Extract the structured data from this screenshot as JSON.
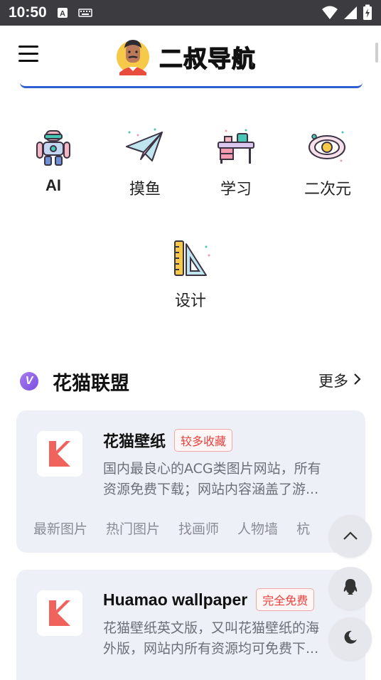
{
  "status_bar": {
    "time": "10:50",
    "icons": [
      "a-notification-icon",
      "keyboard-icon",
      "wifi-icon",
      "signal-icon",
      "battery-charging-icon"
    ]
  },
  "header": {
    "title": "二叔导航",
    "menu_icon": "hamburger-menu-icon",
    "logo_icon": "avatar-logo-icon"
  },
  "categories": [
    {
      "label": "AI",
      "icon": "robot-icon"
    },
    {
      "label": "摸鱼",
      "icon": "paper-plane-icon"
    },
    {
      "label": "学习",
      "icon": "desk-icon"
    },
    {
      "label": "二次元",
      "icon": "planet-icon"
    },
    {
      "label": "设计",
      "icon": "ruler-triangle-icon"
    }
  ],
  "section": {
    "badge": "V",
    "title": "花猫联盟",
    "more": "更多"
  },
  "cards": [
    {
      "title": "花猫壁纸",
      "tag": "较多收藏",
      "desc_line1": "国内最良心的ACG类图片网站，所有",
      "desc_line2": "资源免费下载；网站内容涵盖了游...",
      "links": [
        "最新图片",
        "热门图片",
        "找画师",
        "人物墙",
        "杭"
      ]
    },
    {
      "title": "Huamao wallpaper",
      "tag": "完全免费",
      "desc_line1": "花猫壁纸英文版，又叫花猫壁纸的海",
      "desc_line2": "外版，网站内所有资源均可免费下..."
    }
  ],
  "floating_buttons": [
    "chevron-up-icon",
    "qq-penguin-icon",
    "night-mode-icon"
  ],
  "colors": {
    "accent_blue": "#2f5fd0",
    "tag_red": "#e5413d",
    "card_bg": "#eef0f7",
    "logo_k": "#f0635c"
  }
}
